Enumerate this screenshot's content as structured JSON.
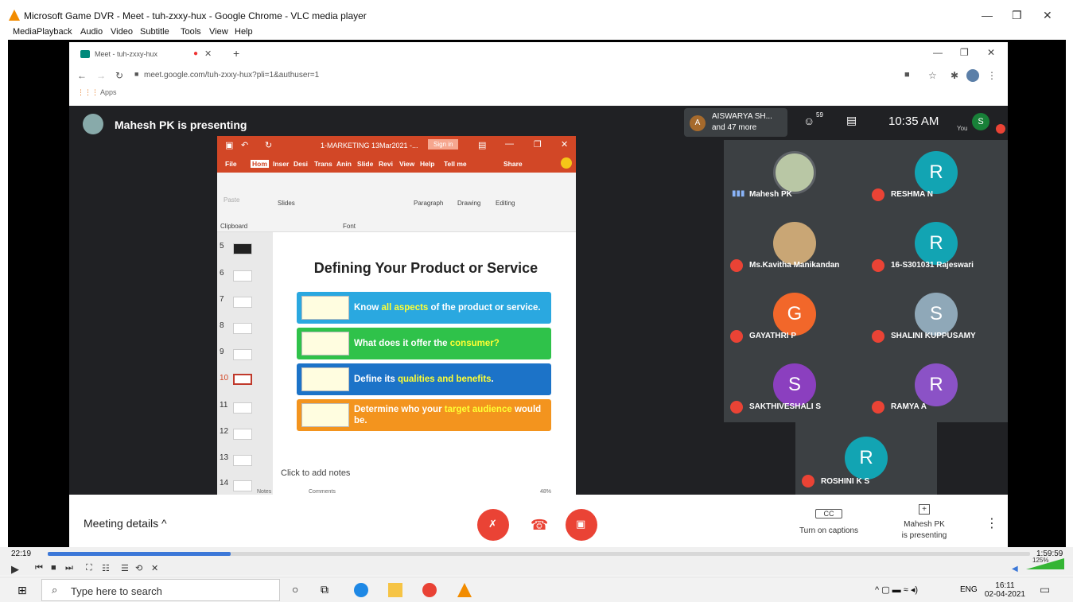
{
  "vlc": {
    "title": "Microsoft Game DVR - Meet - tuh-zxxy-hux - Google Chrome - VLC media player",
    "menu": [
      "Media",
      "Playback",
      "Audio",
      "Video",
      "Subtitle",
      "Tools",
      "View",
      "Help"
    ],
    "time_elapsed": "22:19",
    "time_total": "1:59:59",
    "progress_fraction": 0.186,
    "volume": "125%"
  },
  "chrome": {
    "tab_title": "Meet - tuh-zxxy-hux",
    "url": "meet.google.com/tuh-zxxy-hux?pli=1&authuser=1",
    "bookmarks_apps": "Apps"
  },
  "meet": {
    "presenting_banner": "Mahesh PK is presenting",
    "header_chip_name": "AISWARYA SH...",
    "header_chip_more": "and 47 more",
    "header_chip_initial": "A",
    "people_count": "59",
    "time": "10:35 AM",
    "you_label": "You",
    "you_initial": "S",
    "meeting_details": "Meeting details",
    "captions_label": "Turn on captions",
    "presenting_label_1": "Mahesh PK",
    "presenting_label_2": "is presenting",
    "participants": [
      {
        "name": "Mahesh PK",
        "initial": "",
        "color": "#b9c7a5"
      },
      {
        "name": "RESHMA N",
        "initial": "R",
        "color": "#12a4b3"
      },
      {
        "name": "Ms.Kavitha Manikandan",
        "initial": "",
        "color": "#c9a675"
      },
      {
        "name": "16-S301031 Rajeswari",
        "initial": "R",
        "color": "#12a4b3"
      },
      {
        "name": "GAYATHRI P",
        "initial": "G",
        "color": "#f2672a"
      },
      {
        "name": "SHALINI KUPPUSAMY",
        "initial": "S",
        "color": "#8fa8b8"
      },
      {
        "name": "SAKTHIVESHALI S",
        "initial": "S",
        "color": "#8b3fbf"
      },
      {
        "name": "RAMYA A",
        "initial": "R",
        "color": "#8b52c6"
      }
    ],
    "last_participant": {
      "name": "ROSHINI K S",
      "initial": "R",
      "color": "#12a4b3"
    }
  },
  "ppt": {
    "title": "1-MARKETING 13Mar2021 -...",
    "sign_in": "Sign in",
    "tabs": [
      "File",
      "Hom",
      "Inser",
      "Desi",
      "Trans",
      "Anin",
      "Slide",
      "Revi",
      "View",
      "Help",
      "Tell me",
      "Share"
    ],
    "ribbon": {
      "paste": "Paste",
      "clipboard": "Clipboard",
      "slides": "Slides",
      "font": "Font",
      "paragraph": "Paragraph",
      "drawing": "Drawing",
      "editing": "Editing"
    },
    "slide_numbers": [
      "5",
      "6",
      "7",
      "8",
      "9",
      "10",
      "11",
      "12",
      "13",
      "14"
    ],
    "slide_title": "Defining Your Product or Service",
    "bars": [
      {
        "pre": "Know ",
        "hl": "all aspects",
        "post": " of the product or service.",
        "color": "#2aa8e0"
      },
      {
        "pre": "What does it offer the ",
        "hl": "consumer?",
        "post": "",
        "color": "#2fc24a"
      },
      {
        "pre": "Define its ",
        "hl": "qualities and benefits",
        "post": ".",
        "color": "#1c73c8"
      },
      {
        "pre": "Determine who your ",
        "hl": "target audience",
        "post": " would be.",
        "color": "#f3941e"
      }
    ],
    "notes": "Click to add notes",
    "status_notes": "Notes",
    "status_comments": "Comments",
    "zoom": "48%"
  },
  "taskbar": {
    "search_placeholder": "Type here to search",
    "lang": "ENG",
    "time": "16:11",
    "date": "02-04-2021"
  }
}
